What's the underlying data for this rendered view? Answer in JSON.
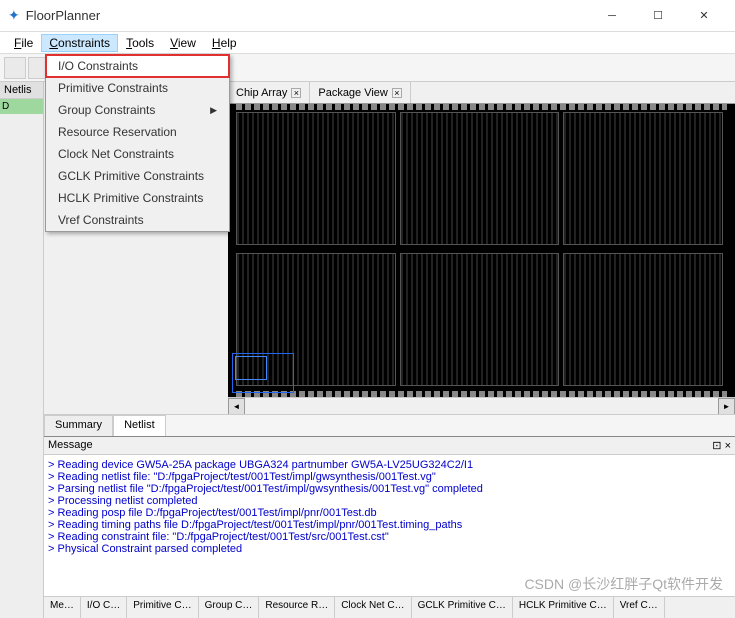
{
  "window": {
    "title": "FloorPlanner"
  },
  "menu": {
    "items": [
      "File",
      "Constraints",
      "Tools",
      "View",
      "Help"
    ],
    "active_index": 1
  },
  "dropdown": {
    "items": [
      {
        "label": "I/O Constraints",
        "highlighted": true
      },
      {
        "label": "Primitive Constraints"
      },
      {
        "label": "Group Constraints",
        "submenu": true
      },
      {
        "label": "Resource Reservation"
      },
      {
        "label": "Clock Net Constraints"
      },
      {
        "label": "GCLK Primitive Constraints"
      },
      {
        "label": "HCLK Primitive Constraints"
      },
      {
        "label": "Vref Constraints"
      }
    ]
  },
  "left_panel": {
    "netlist_label": "Netlis",
    "tree_root": "D"
  },
  "canvas_tabs": {
    "tabs": [
      "Chip Array",
      "Package View"
    ]
  },
  "bottom_tabs1": {
    "tabs": [
      "Summary",
      "Netlist"
    ],
    "active": "Netlist"
  },
  "message": {
    "header": "Message",
    "lines": [
      "Reading device GW5A-25A package UBGA324 partnumber GW5A-LV25UG324C2/I1",
      "Reading netlist file: \"D:/fpgaProject/test/001Test/impl/gwsynthesis/001Test.vg\"",
      "Parsing netlist file \"D:/fpgaProject/test/001Test/impl/gwsynthesis/001Test.vg\" completed",
      "Processing netlist completed",
      "Reading posp file D:/fpgaProject/test/001Test/impl/pnr/001Test.db",
      "Reading timing paths file D:/fpgaProject/test/001Test/impl/pnr/001Test.timing_paths",
      "Reading constraint file: \"D:/fpgaProject/test/001Test/src/001Test.cst\"",
      "Physical Constraint parsed completed"
    ]
  },
  "status_tabs": {
    "items": [
      "Me…",
      "I/O C…",
      "Primitive C…",
      "Group C…",
      "Resource R…",
      "Clock Net C…",
      "GCLK Primitive C…",
      "HCLK Primitive C…",
      "Vref C…"
    ]
  },
  "watermark": "CSDN @长沙红胖子Qt软件开发"
}
